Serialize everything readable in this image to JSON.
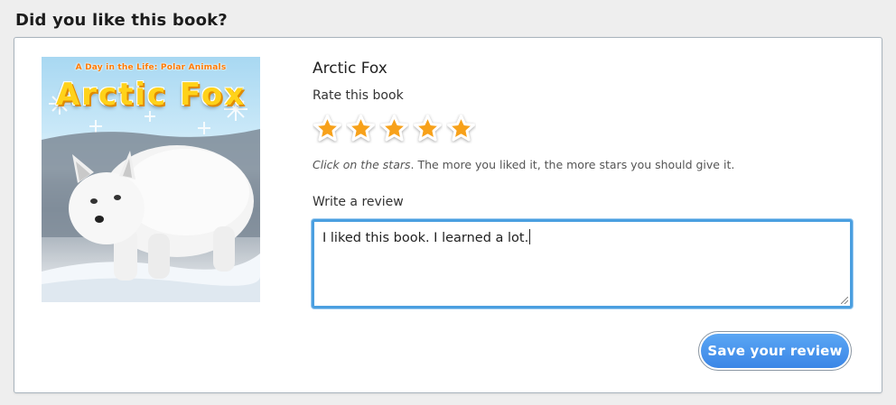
{
  "page": {
    "title": "Did you like this book?"
  },
  "book": {
    "title": "Arctic Fox",
    "cover": {
      "series_text": "A Day in the Life: Polar Animals",
      "title_text": "Arctic Fox",
      "image": "arctic-fox-cover"
    }
  },
  "rating": {
    "label": "Rate this book",
    "value": 5,
    "max": 5,
    "star_color": "#f7a11a",
    "hint_emphasis": "Click on the stars",
    "hint_rest": ". The more you liked it, the more stars you should give it."
  },
  "review": {
    "label": "Write a review",
    "value": "I liked this book. I learned a lot."
  },
  "actions": {
    "save_label": "Save your review",
    "accent_color": "#3b86e6"
  }
}
